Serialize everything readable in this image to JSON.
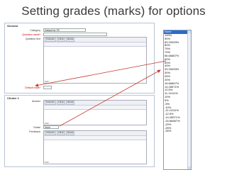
{
  "slide": {
    "title": "Setting grades (marks) for options"
  },
  "general": {
    "title": "General",
    "category_label": "Category",
    "category_value": "Default for FE",
    "question_name_label": "Question name*",
    "question_text_label": "Question text",
    "path_label": "Path:",
    "default_mark_label": "Default mark*"
  },
  "toolbar": {
    "font": "Trebuchet",
    "size": "1 (8 pt)",
    "format": "Normal"
  },
  "choice": {
    "title": "Choice 1",
    "answer_label": "Answer",
    "grade_label": "Grade",
    "grade_value": "None",
    "feedback_label": "Feedback",
    "path_label": "Path:"
  },
  "grades_dropdown": {
    "items": [
      "None",
      "100%",
      "90%",
      "83.33333%",
      "80%",
      "75%",
      "70%",
      "66.66667%",
      "60%",
      "50%",
      "40%",
      "33.33333%",
      "30%",
      "25%",
      "20%",
      "16.66667%",
      "14.28571%",
      "12.5%",
      "11.11111%",
      "10%",
      "5%",
      "-5%",
      "-10%",
      "-11.11111%",
      "-12.5%",
      "-14.28571%",
      "-16.66667%",
      "-20%",
      "-25%",
      "-30%"
    ],
    "selected": "None"
  },
  "colors": {
    "selected_bg": "#3169c6",
    "arrow": "#c0392b"
  }
}
